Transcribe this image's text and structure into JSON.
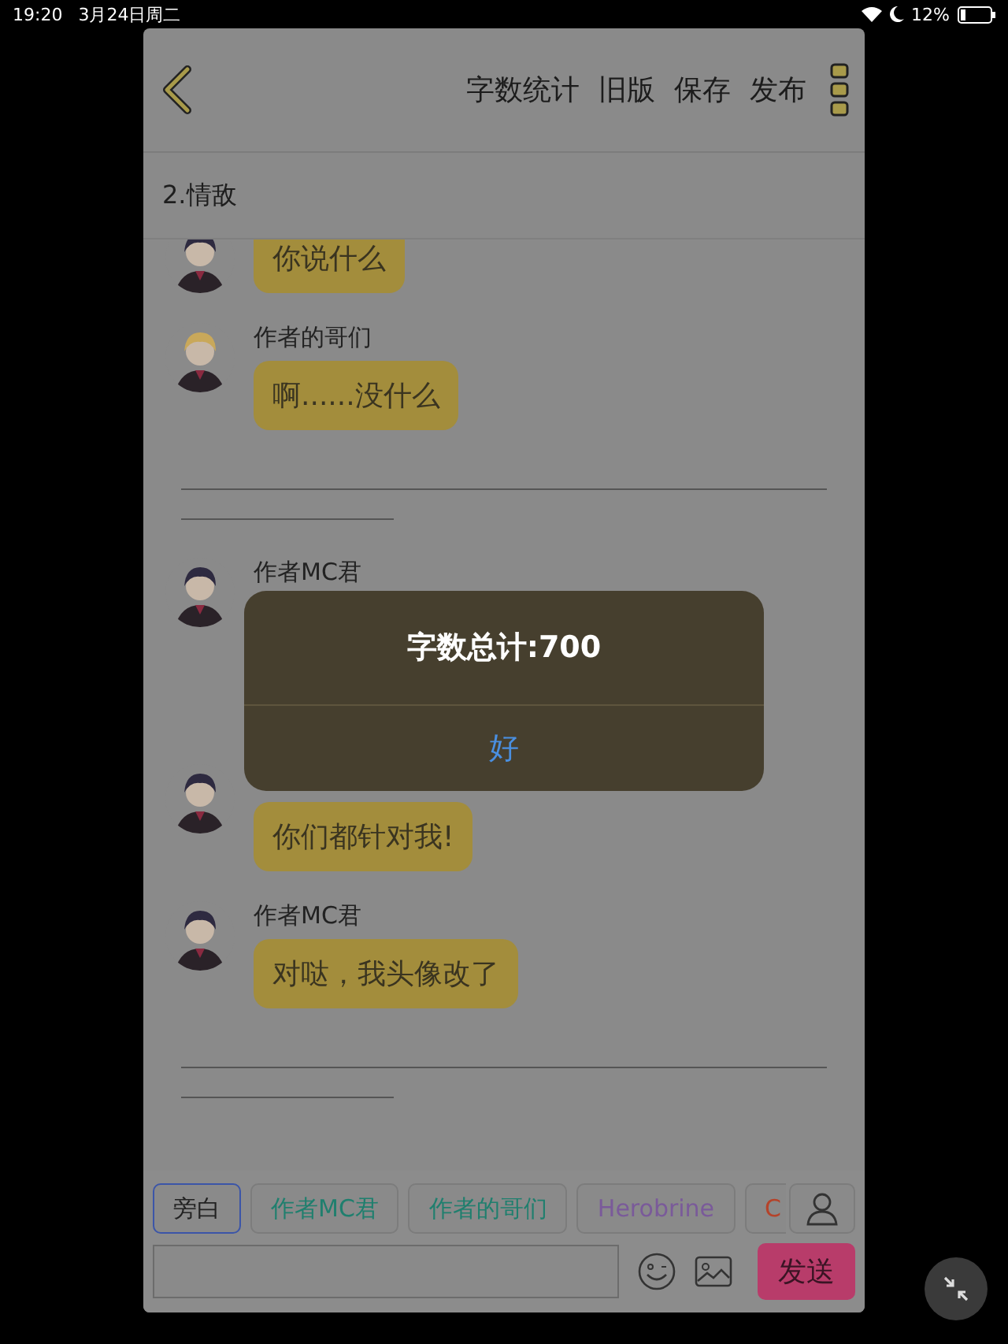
{
  "status_bar": {
    "time": "19:20",
    "date": "3月24日周二",
    "battery": "12%"
  },
  "header": {
    "actions": [
      "字数统计",
      "旧版",
      "保存",
      "发布"
    ]
  },
  "chapter_title": "2.情敌",
  "messages": [
    {
      "kind": "message",
      "text": "你说什么"
    },
    {
      "kind": "message",
      "name": "作者的哥们",
      "text": "啊......没什么"
    },
    {
      "kind": "divider"
    },
    {
      "kind": "message",
      "name": "作者MC君"
    },
    {
      "kind": "message",
      "text": "你们都针对我!"
    },
    {
      "kind": "message",
      "name": "作者MC君",
      "text": "对哒，我头像改了"
    },
    {
      "kind": "divider"
    }
  ],
  "characters": [
    {
      "label": "旁白",
      "selected": true,
      "color": "#222222"
    },
    {
      "label": "作者MC君",
      "selected": false,
      "color": "#1f7f6e"
    },
    {
      "label": "作者的哥们",
      "selected": false,
      "color": "#1f7f6e"
    },
    {
      "label": "Herobrine",
      "selected": false,
      "color": "#7a5a9a"
    },
    {
      "label": "C",
      "selected": false,
      "color": "#b5432a"
    }
  ],
  "composer": {
    "send": "发送"
  },
  "alert": {
    "message": "字数总计:700",
    "button": "好"
  }
}
